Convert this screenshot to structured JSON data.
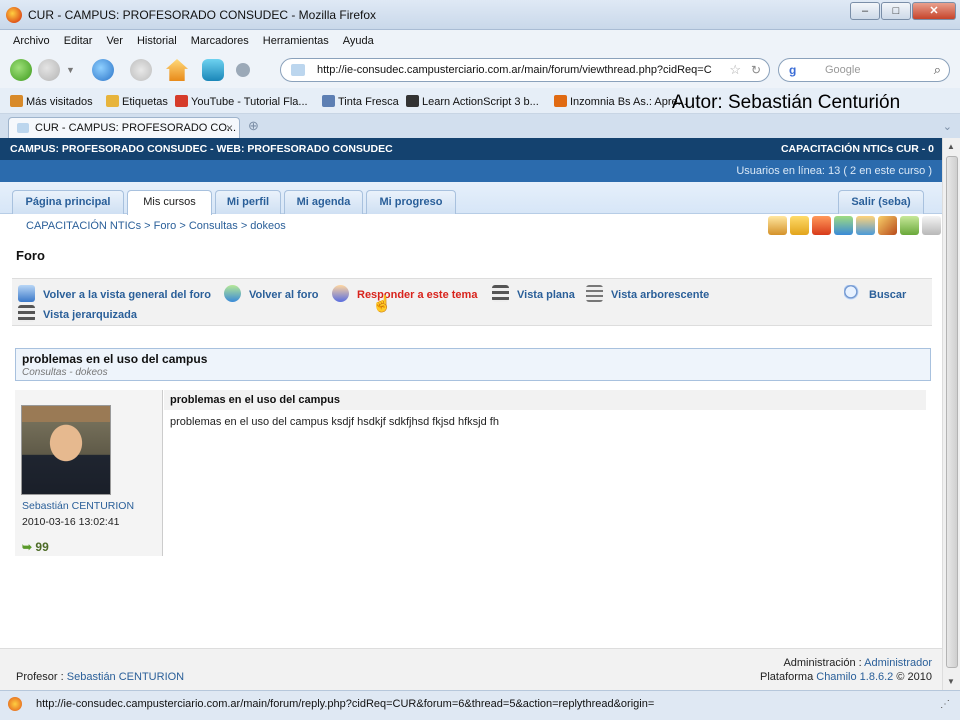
{
  "window": {
    "title": "CUR - CAMPUS: PROFESORADO CONSUDEC - Mozilla Firefox",
    "minimize": "–",
    "maximize": "□",
    "close": "✕"
  },
  "menu": [
    "Archivo",
    "Editar",
    "Ver",
    "Historial",
    "Marcadores",
    "Herramientas",
    "Ayuda"
  ],
  "url": "http://ie-consudec.campusterciario.com.ar/main/forum/viewthread.php?cidReq=C",
  "search_placeholder": "Google",
  "bookmarks": [
    {
      "label": "Más visitados",
      "color": "#d88a2a"
    },
    {
      "label": "Etiquetas",
      "color": "#e7b43c"
    },
    {
      "label": "YouTube - Tutorial Fla...",
      "color": "#d63b2a"
    },
    {
      "label": "Tinta Fresca",
      "color": "#5d7fb3"
    },
    {
      "label": "Learn ActionScript 3 b...",
      "color": "#333333"
    },
    {
      "label": "Inzomnia Bs As.: Apre...",
      "color": "#e06a12"
    }
  ],
  "watermark": "Autor: Sebastián Centurión",
  "browser_tab": {
    "label": "CUR - CAMPUS: PROFESORADO CO..."
  },
  "site": {
    "header_left": "CAMPUS: PROFESORADO CONSUDEC - WEB: PROFESORADO CONSUDEC",
    "header_right": "CAPACITACIÓN NTICs CUR - 0",
    "users_online": "Usuarios en línea: 13  ( 2 en este curso  )"
  },
  "nav_tabs": [
    {
      "label": "Página principal",
      "active": false
    },
    {
      "label": "Mis cursos",
      "active": true
    },
    {
      "label": "Mi perfil",
      "active": false
    },
    {
      "label": "Mi agenda",
      "active": false
    },
    {
      "label": "Mi progreso",
      "active": false
    }
  ],
  "logout": "Salir (seba)",
  "breadcrumb": [
    "CAPACITACIÓN NTICs",
    "Foro",
    "Consultas",
    "dokeos"
  ],
  "page_title": "Foro",
  "actions": {
    "back_overview": "Volver a la vista general del foro",
    "back_forum": "Volver al foro",
    "reply": "Responder a este tema",
    "flat_view": "Vista plana",
    "tree_view": "Vista arborescente",
    "search": "Buscar",
    "nested_view": "Vista jerarquizada"
  },
  "thread": {
    "title": "problemas en el uso del campus",
    "subtitle": "Consultas - dokeos"
  },
  "post": {
    "author": "Sebastián CENTURION",
    "date": "2010-03-16 13:02:41",
    "title": "problemas en el uso del campus",
    "body": "problemas en el uso del campus ksdjf hsdkjf sdkfjhsd fkjsd hfksjd fh",
    "quote_icon": "99"
  },
  "footer": {
    "teacher_label": "Profesor : ",
    "teacher_name": "Sebastián CENTURION",
    "admin_label": "Administración : ",
    "admin_name": "Administrador",
    "platform_label": "Plataforma ",
    "platform_name": "Chamilo 1.8.6.2",
    "platform_suffix": " © 2010"
  },
  "status_url": "http://ie-consudec.campusterciario.com.ar/main/forum/reply.php?cidReq=CUR&forum=6&thread=5&action=replythread&origin="
}
